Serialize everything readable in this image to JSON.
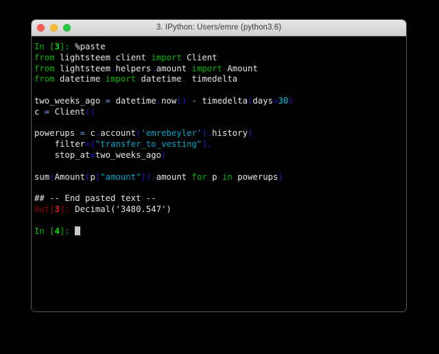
{
  "window": {
    "title": "3. IPython: Users/emre (python3.6)",
    "traffic_lights": [
      {
        "name": "close",
        "color": "#ff5f57"
      },
      {
        "name": "minimize",
        "color": "#ffbd2e"
      },
      {
        "name": "zoom",
        "color": "#28c840"
      }
    ]
  },
  "theme": {
    "background": "#000000",
    "foreground": "#d8d8d8",
    "keyword": "#00b800",
    "prompt_in": "#00c000",
    "prompt_out": "#9e0000",
    "punctuation": "#1a1ad0",
    "string": "#00a8c8",
    "number": "#00c8e0",
    "operator": "#6ea8ff",
    "cursor": "#c8c8c8"
  },
  "console": {
    "prompt_in_label": "In",
    "prompt_out_label": "Out",
    "current_prompt_number": "4",
    "lines": [
      {
        "id": "line-in-3",
        "tokens": [
          {
            "t": "In ",
            "c": "tok-green"
          },
          {
            "t": "[",
            "c": "tok-green"
          },
          {
            "t": "3",
            "c": "tok-green-b"
          },
          {
            "t": "]",
            "c": "tok-green"
          },
          {
            "t": ": ",
            "c": "tok-green"
          },
          {
            "t": "%paste",
            "c": "tok-white"
          }
        ]
      },
      {
        "id": "line-import-client",
        "tokens": [
          {
            "t": "from ",
            "c": "tok-kw"
          },
          {
            "t": "lightsteem",
            "c": "tok-white"
          },
          {
            "t": ".",
            "c": "tok-blue"
          },
          {
            "t": "client ",
            "c": "tok-white"
          },
          {
            "t": "import ",
            "c": "tok-kw"
          },
          {
            "t": "Client",
            "c": "tok-white"
          }
        ]
      },
      {
        "id": "line-import-amount",
        "tokens": [
          {
            "t": "from ",
            "c": "tok-kw"
          },
          {
            "t": "lightsteem",
            "c": "tok-white"
          },
          {
            "t": ".",
            "c": "tok-blue"
          },
          {
            "t": "helpers",
            "c": "tok-white"
          },
          {
            "t": ".",
            "c": "tok-blue"
          },
          {
            "t": "amount ",
            "c": "tok-white"
          },
          {
            "t": "import ",
            "c": "tok-kw"
          },
          {
            "t": "Amount",
            "c": "tok-white"
          }
        ]
      },
      {
        "id": "line-import-datetime",
        "tokens": [
          {
            "t": "from ",
            "c": "tok-kw"
          },
          {
            "t": "datetime ",
            "c": "tok-white"
          },
          {
            "t": "import ",
            "c": "tok-kw"
          },
          {
            "t": "datetime",
            "c": "tok-white"
          },
          {
            "t": ",",
            "c": "tok-blue"
          },
          {
            "t": " timedelta",
            "c": "tok-white"
          }
        ]
      },
      {
        "id": "blank-1",
        "blank": true
      },
      {
        "id": "line-two-weeks-ago",
        "tokens": [
          {
            "t": "two_weeks_ago ",
            "c": "tok-white"
          },
          {
            "t": "=",
            "c": "tok-op"
          },
          {
            "t": " datetime",
            "c": "tok-white"
          },
          {
            "t": ".",
            "c": "tok-blue"
          },
          {
            "t": "now",
            "c": "tok-white"
          },
          {
            "t": "()",
            "c": "tok-blue"
          },
          {
            "t": " ",
            "c": "tok-white"
          },
          {
            "t": "-",
            "c": "tok-op"
          },
          {
            "t": " timedelta",
            "c": "tok-white"
          },
          {
            "t": "(",
            "c": "tok-blue"
          },
          {
            "t": "days",
            "c": "tok-white"
          },
          {
            "t": "=",
            "c": "tok-blue"
          },
          {
            "t": "30",
            "c": "tok-num"
          },
          {
            "t": ")",
            "c": "tok-blue"
          }
        ]
      },
      {
        "id": "line-c-client",
        "tokens": [
          {
            "t": "c ",
            "c": "tok-white"
          },
          {
            "t": "=",
            "c": "tok-op"
          },
          {
            "t": " Client",
            "c": "tok-white"
          },
          {
            "t": "()",
            "c": "tok-blue"
          }
        ]
      },
      {
        "id": "blank-2",
        "blank": true
      },
      {
        "id": "line-powerups",
        "tokens": [
          {
            "t": "powerups ",
            "c": "tok-white"
          },
          {
            "t": "=",
            "c": "tok-op"
          },
          {
            "t": " c",
            "c": "tok-white"
          },
          {
            "t": ".",
            "c": "tok-blue"
          },
          {
            "t": "account",
            "c": "tok-white"
          },
          {
            "t": "(",
            "c": "tok-blue"
          },
          {
            "t": "'emrebeyler'",
            "c": "tok-cyan"
          },
          {
            "t": ")",
            "c": "tok-blue"
          },
          {
            "t": ".",
            "c": "tok-blue"
          },
          {
            "t": "history",
            "c": "tok-white"
          },
          {
            "t": "(",
            "c": "tok-blue"
          }
        ]
      },
      {
        "id": "line-filter",
        "tokens": [
          {
            "t": "    filter",
            "c": "tok-white"
          },
          {
            "t": "=[",
            "c": "tok-blue"
          },
          {
            "t": "\"transfer_to_vesting\"",
            "c": "tok-cyan"
          },
          {
            "t": "],",
            "c": "tok-blue"
          }
        ]
      },
      {
        "id": "line-stop-at",
        "tokens": [
          {
            "t": "    stop_at",
            "c": "tok-white"
          },
          {
            "t": "=",
            "c": "tok-blue"
          },
          {
            "t": "two_weeks_ago",
            "c": "tok-white"
          },
          {
            "t": ")",
            "c": "tok-blue"
          }
        ]
      },
      {
        "id": "blank-3",
        "blank": true
      },
      {
        "id": "line-sum",
        "tokens": [
          {
            "t": "sum",
            "c": "tok-white"
          },
          {
            "t": "(",
            "c": "tok-blue"
          },
          {
            "t": "Amount",
            "c": "tok-white"
          },
          {
            "t": "(",
            "c": "tok-blue"
          },
          {
            "t": "p",
            "c": "tok-white"
          },
          {
            "t": "[",
            "c": "tok-blue"
          },
          {
            "t": "\"amount\"",
            "c": "tok-cyan"
          },
          {
            "t": "])",
            "c": "tok-blue"
          },
          {
            "t": ".",
            "c": "tok-blue"
          },
          {
            "t": "amount ",
            "c": "tok-white"
          },
          {
            "t": "for ",
            "c": "tok-kw"
          },
          {
            "t": "p ",
            "c": "tok-white"
          },
          {
            "t": "in ",
            "c": "tok-kw"
          },
          {
            "t": "powerups",
            "c": "tok-white"
          },
          {
            "t": ")",
            "c": "tok-blue"
          }
        ]
      },
      {
        "id": "blank-4",
        "blank": true
      },
      {
        "id": "line-end-pasted",
        "tokens": [
          {
            "t": "## -- End pasted text --",
            "c": "tok-white"
          }
        ]
      },
      {
        "id": "line-out-3",
        "tokens": [
          {
            "t": "Out",
            "c": "tok-red"
          },
          {
            "t": "[",
            "c": "tok-red"
          },
          {
            "t": "3",
            "c": "tok-red-b"
          },
          {
            "t": "]",
            "c": "tok-red"
          },
          {
            "t": ": ",
            "c": "tok-red"
          },
          {
            "t": "Decimal('3480.547')",
            "c": "tok-white"
          }
        ]
      },
      {
        "id": "blank-5",
        "blank": true
      },
      {
        "id": "line-in-4",
        "tokens": [
          {
            "t": "In ",
            "c": "tok-green"
          },
          {
            "t": "[",
            "c": "tok-green"
          },
          {
            "t": "4",
            "c": "tok-green-b"
          },
          {
            "t": "]",
            "c": "tok-green"
          },
          {
            "t": ": ",
            "c": "tok-green"
          }
        ],
        "cursor": true
      }
    ]
  }
}
